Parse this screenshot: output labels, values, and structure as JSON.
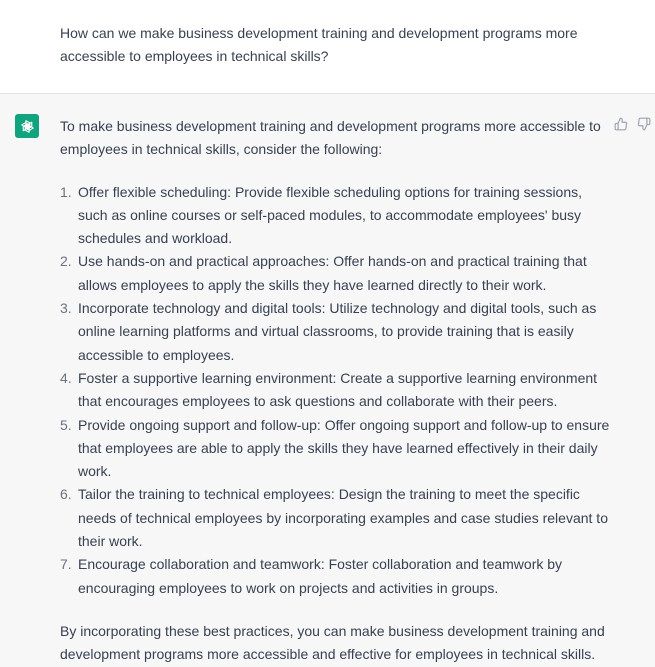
{
  "user": {
    "message": "How can we make business development training and development programs more accessible to employees in technical skills?"
  },
  "assistant": {
    "avatar_icon": "openai-logo-icon",
    "avatar_color": "#10a37f",
    "intro": "To make business development training and development programs more accessible to employees in technical skills, consider the following:",
    "items": [
      {
        "num": "1.",
        "text": "Offer flexible scheduling: Provide flexible scheduling options for training sessions, such as online courses or self-paced modules, to accommodate employees' busy schedules and workload."
      },
      {
        "num": "2.",
        "text": "Use hands-on and practical approaches: Offer hands-on and practical training that allows employees to apply the skills they have learned directly to their work."
      },
      {
        "num": "3.",
        "text": "Incorporate technology and digital tools: Utilize technology and digital tools, such as online learning platforms and virtual classrooms, to provide training that is easily accessible to employees."
      },
      {
        "num": "4.",
        "text": "Foster a supportive learning environment: Create a supportive learning environment that encourages employees to ask questions and collaborate with their peers."
      },
      {
        "num": "5.",
        "text": "Provide ongoing support and follow-up: Offer ongoing support and follow-up to ensure that employees are able to apply the skills they have learned effectively in their daily work."
      },
      {
        "num": "6.",
        "text": "Tailor the training to technical employees: Design the training to meet the specific needs of technical employees by incorporating examples and case studies relevant to their work."
      },
      {
        "num": "7.",
        "text": "Encourage collaboration and teamwork: Foster collaboration and teamwork by encouraging employees to work on projects and activities in groups."
      }
    ],
    "conclusion": "By incorporating these best practices, you can make business development training and development programs more accessible and effective for employees in technical skills.",
    "feedback": {
      "thumbs_up_icon": "thumbs-up-icon",
      "thumbs_down_icon": "thumbs-down-icon"
    }
  }
}
